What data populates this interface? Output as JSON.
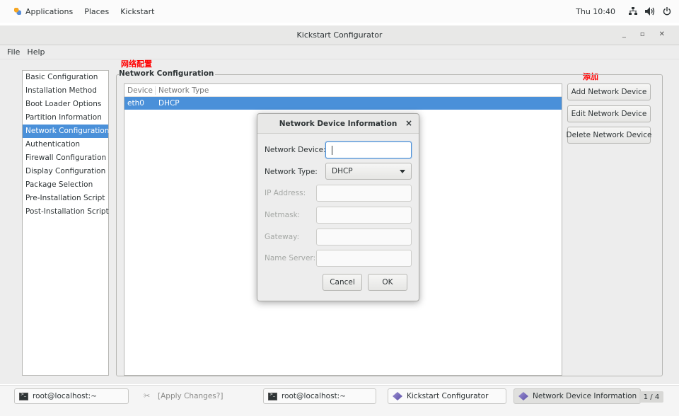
{
  "topbar": {
    "applications": "Applications",
    "places": "Places",
    "app_name": "Kickstart",
    "clock": "Thu 10:40",
    "network_icon": "network-wired-icon",
    "volume_icon": "volume-icon",
    "power_icon": "power-icon"
  },
  "window": {
    "title": "Kickstart Configurator"
  },
  "menubar": {
    "items": [
      "File",
      "Help"
    ]
  },
  "sidebar": {
    "items": [
      {
        "label": "Basic Configuration"
      },
      {
        "label": "Installation Method"
      },
      {
        "label": "Boot Loader Options"
      },
      {
        "label": "Partition Information"
      },
      {
        "label": "Network Configuration",
        "selected": true
      },
      {
        "label": "Authentication"
      },
      {
        "label": "Firewall Configuration"
      },
      {
        "label": "Display Configuration"
      },
      {
        "label": "Package Selection"
      },
      {
        "label": "Pre-Installation Script"
      },
      {
        "label": "Post-Installation Script"
      }
    ]
  },
  "annotations": {
    "network_config": "网络配置",
    "add": "添加",
    "color": "#ff0000"
  },
  "network": {
    "frame_label": "Network Configuration",
    "columns": [
      "Device",
      "Network Type"
    ],
    "rows": [
      {
        "device": "eth0",
        "type": "DHCP",
        "selected": true
      }
    ],
    "buttons": {
      "add": "Add Network Device",
      "edit": "Edit Network Device",
      "delete": "Delete Network Device"
    }
  },
  "dialog": {
    "title": "Network Device Information",
    "close": "×",
    "device_label": "Network Device:",
    "device_value": "",
    "type_label": "Network Type:",
    "type_value": "DHCP",
    "ip_label": "IP Address:",
    "netmask_label": "Netmask:",
    "gateway_label": "Gateway:",
    "nameserver_label": "Name Server:",
    "cancel": "Cancel",
    "ok": "OK"
  },
  "taskbar": {
    "tasks": [
      {
        "label": "root@localhost:~",
        "icon": "terminal-icon"
      },
      {
        "label": "[Apply Changes?]",
        "icon": "tools-icon"
      },
      {
        "label": "root@localhost:~",
        "icon": "terminal-icon"
      },
      {
        "label": "Kickstart Configurator",
        "icon": "kickstart-icon"
      },
      {
        "label": "Network Device Information",
        "icon": "kickstart-icon"
      }
    ],
    "pager": "1 / 4"
  },
  "colors": {
    "selection": "#4a90d9",
    "accent": "#4a90d9"
  }
}
